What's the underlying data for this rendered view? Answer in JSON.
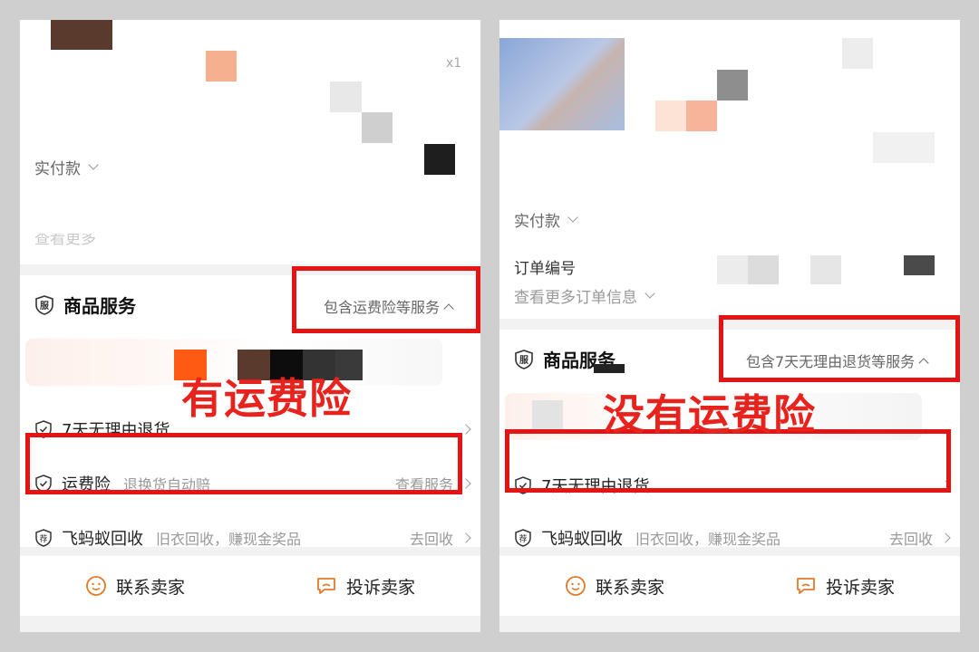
{
  "colors": {
    "accent_orange": "#e07a2c",
    "annotation_red": "#e41414"
  },
  "left": {
    "qty": "x1",
    "paid_label": "实付款",
    "partial_text": "查看更多",
    "service_title": "商品服务",
    "service_summary": "包含运费险等服务",
    "annotation": "有运费险",
    "rows": [
      {
        "name": "7天无理由退货",
        "desc": "",
        "action": ""
      },
      {
        "name": "运费险",
        "desc": "退换货自动赔",
        "action": "查看服务"
      },
      {
        "name": "飞蚂蚁回收",
        "desc": "旧衣回收，赚现金奖品",
        "action": "去回收"
      }
    ],
    "contact_seller": "联系卖家",
    "complain_seller": "投诉卖家"
  },
  "right": {
    "paid_label": "实付款",
    "order_no_label": "订单编号",
    "more_info": "查看更多订单信息",
    "service_title": "商品服务",
    "service_summary": "包含7天无理由退货等服务",
    "annotation": "没有运费险",
    "rows": [
      {
        "name": "7天无理由退货",
        "desc": "",
        "action": ""
      },
      {
        "name": "飞蚂蚁回收",
        "desc": "旧衣回收，赚现金奖品",
        "action": "去回收"
      }
    ],
    "contact_seller": "联系卖家",
    "complain_seller": "投诉卖家"
  },
  "icons": {
    "service_badge": "shield-fu-icon",
    "check": "shield-check-icon",
    "recycle": "jian-badge-icon",
    "contact": "chat-face-icon",
    "complain": "complaint-bubble-icon"
  }
}
